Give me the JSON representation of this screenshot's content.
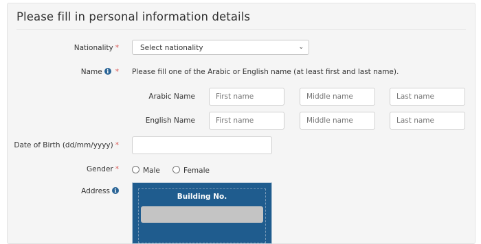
{
  "form": {
    "title": "Please fill in personal information details",
    "required_mark": "*",
    "nationality": {
      "label": "Nationality",
      "selected": "Select nationality"
    },
    "name": {
      "label": "Name",
      "note": "Please fill one of the Arabic or English name (at least first and last name)."
    },
    "arabic_name": {
      "label": "Arabic Name",
      "first_placeholder": "First name",
      "middle_placeholder": "Middle name",
      "last_placeholder": "Last name"
    },
    "english_name": {
      "label": "English Name",
      "first_placeholder": "First name",
      "middle_placeholder": "Middle name",
      "last_placeholder": "Last name"
    },
    "dob": {
      "label": "Date of Birth (dd/mm/yyyy)"
    },
    "gender": {
      "label": "Gender",
      "options": [
        "Male",
        "Female"
      ]
    },
    "address": {
      "label": "Address",
      "building_label": "Building No."
    }
  },
  "icons": {
    "info": "info-circle-icon",
    "dropdown": "chevron-down-icon"
  },
  "colors": {
    "required": "#d9534f",
    "info_icon": "#2a6496",
    "address_panel": "#1f5c8e"
  }
}
